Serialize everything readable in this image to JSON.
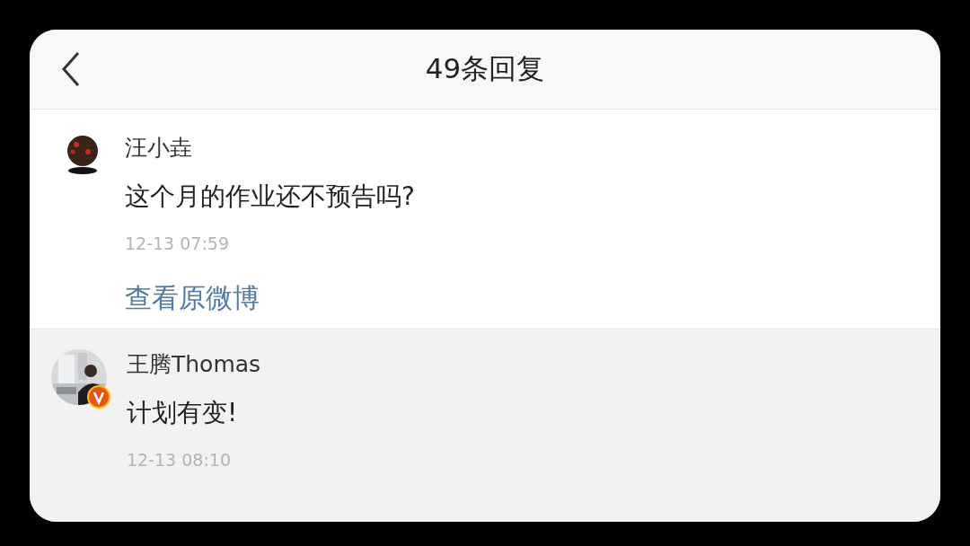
{
  "header": {
    "title": "49条回复"
  },
  "comments": [
    {
      "name": "汪小垚",
      "text": "这个月的作业还不预告吗?",
      "time": "12-13 07:59",
      "link": "查看原微博",
      "highlighted": false,
      "verified": false
    },
    {
      "name": "王腾Thomas",
      "text": "计划有变!",
      "time": "12-13 08:10",
      "highlighted": true,
      "verified": true
    }
  ]
}
